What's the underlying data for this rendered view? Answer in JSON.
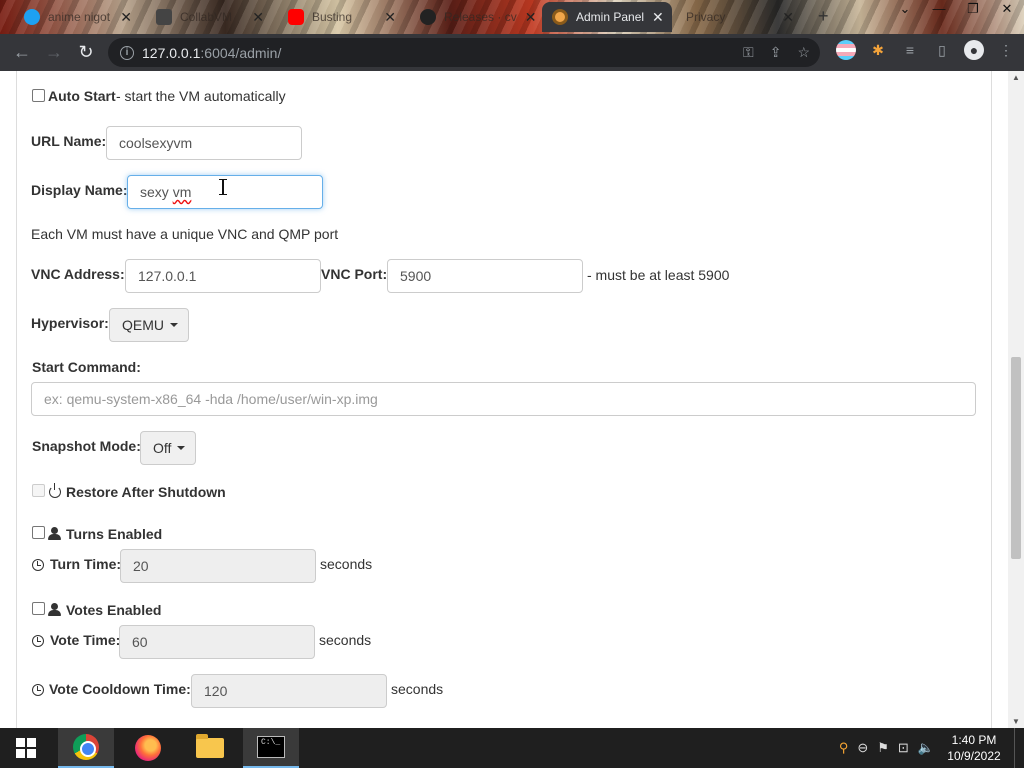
{
  "browser": {
    "tabs": [
      {
        "label": "anime nigot",
        "icon": "twitter-icon"
      },
      {
        "label": "CollabVM",
        "icon": "collabvm-icon"
      },
      {
        "label": "Busting",
        "icon": "youtube-icon"
      },
      {
        "label": "Releases · cv",
        "icon": "github-icon"
      },
      {
        "label": "Admin Panel",
        "icon": "admin-panel-icon",
        "active": true
      },
      {
        "label": "Privacy",
        "icon": "none"
      }
    ],
    "url_host": "127.0.0.1",
    "url_rest": ":6004/admin/"
  },
  "form": {
    "auto_start": {
      "label": "Auto Start",
      "desc": "- start the VM automatically",
      "checked": false
    },
    "url_name": {
      "label": "URL Name:",
      "value": "coolsexyvm"
    },
    "display_name": {
      "label": "Display Name:",
      "value_a": "sexy ",
      "value_b": "vm"
    },
    "unique_note": "Each VM must have a unique VNC and QMP port",
    "vnc_address": {
      "label": "VNC Address:",
      "value": "127.0.0.1"
    },
    "vnc_port": {
      "label": "VNC Port:",
      "value": "5900",
      "note": "- must be at least 5900"
    },
    "hypervisor": {
      "label": "Hypervisor:",
      "value": "QEMU"
    },
    "start_command": {
      "label": "Start Command:",
      "placeholder": "ex: qemu-system-x86_64 -hda /home/user/win-xp.img"
    },
    "snapshot_mode": {
      "label": "Snapshot Mode:",
      "value": "Off"
    },
    "restore_after_shutdown": {
      "label": "Restore After Shutdown",
      "checked": false,
      "disabled": true
    },
    "turns_enabled": {
      "label": "Turns Enabled",
      "checked": false
    },
    "turn_time": {
      "label": "Turn Time:",
      "value": "20",
      "unit": "seconds"
    },
    "votes_enabled": {
      "label": "Votes Enabled",
      "checked": false
    },
    "vote_time": {
      "label": "Vote Time:",
      "value": "60",
      "unit": "seconds"
    },
    "vote_cooldown": {
      "label": "Vote Cooldown Time:",
      "value": "120",
      "unit": "seconds"
    }
  },
  "taskbar": {
    "time": "1:40 PM",
    "date": "10/9/2022"
  }
}
